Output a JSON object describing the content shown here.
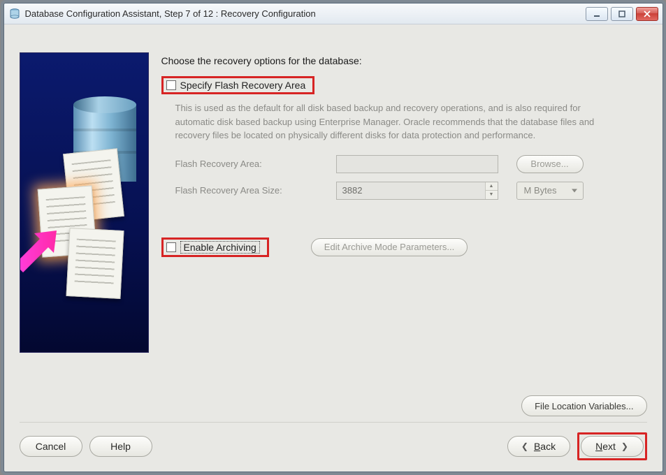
{
  "window": {
    "title": "Database Configuration Assistant, Step 7 of 12 : Recovery Configuration"
  },
  "content": {
    "heading": "Choose the recovery options for the database:",
    "specify_flash_label": "Specify Flash Recovery Area",
    "specify_flash_checked": false,
    "description": "This is used as the default for all disk based backup and recovery operations, and is also required for automatic disk based backup using Enterprise Manager. Oracle recommends that the database files and recovery files be located on physically different disks for data protection and performance.",
    "flash_area_label": "Flash Recovery Area:",
    "flash_area_value": "",
    "browse_label": "Browse...",
    "flash_size_label": "Flash Recovery Area Size:",
    "flash_size_value": "3882",
    "flash_size_unit": "M Bytes",
    "enable_archiving_label": "Enable Archiving",
    "enable_archiving_checked": false,
    "edit_archive_label": "Edit Archive Mode Parameters...",
    "file_location_vars_label": "File Location Variables..."
  },
  "nav": {
    "cancel": "Cancel",
    "help": "Help",
    "back_u": "B",
    "back_rest": "ack",
    "next_u": "N",
    "next_rest": "ext"
  }
}
